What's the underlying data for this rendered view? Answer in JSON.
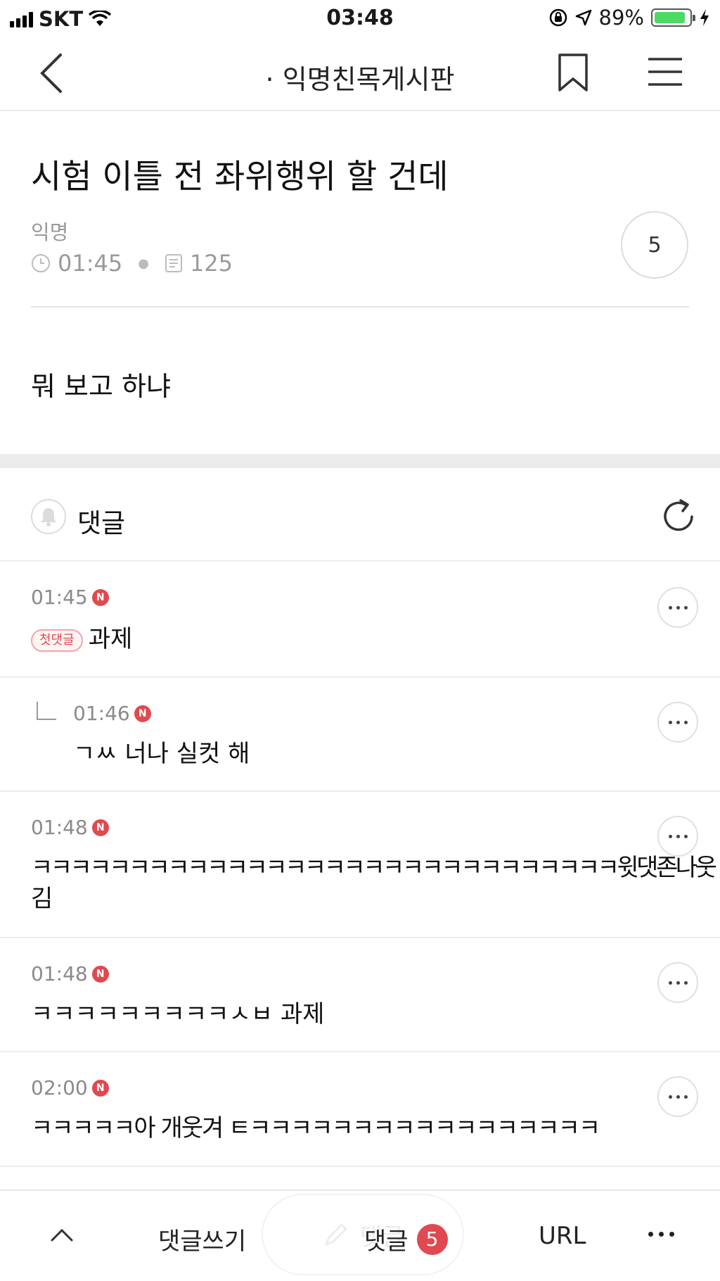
{
  "status_bar": {
    "carrier": "SKT",
    "time": "03:48",
    "battery": "89%",
    "battery_level": 0.89
  },
  "nav": {
    "title": "· 익명친목게시판"
  },
  "post": {
    "title": "시험 이틀 전 좌위행위 할 건데",
    "author": "익명",
    "time": "01:45",
    "views": "125",
    "comment_count": "5",
    "body": "뭐 보고 하냐"
  },
  "comments_section": {
    "title": "댓글"
  },
  "comments": [
    {
      "time": "01:45",
      "badge": "N",
      "tag": "첫댓글",
      "text": "과제",
      "is_reply": false
    },
    {
      "time": "01:46",
      "badge": "N",
      "text": "ㄱㅆ 너나 실컷 해",
      "is_reply": true
    },
    {
      "time": "01:48",
      "badge": "N",
      "text": "ㅋㅋㅋㅋㅋㅋㅋㅋㅋㅋㅋㅋㅋㅋㅋㅋㅋㅋㅋㅋㅋㅋㅋㅋㅋㅋㅋㅋㅋㅋ윗댓존나웃",
      "text_line2": "김",
      "is_reply": false
    },
    {
      "time": "01:48",
      "badge": "N",
      "text": "ㅋㅋㅋㅋㅋㅋㅋㅋㅋㅅㅂ 과제",
      "is_reply": false
    },
    {
      "time": "02:00",
      "badge": "N",
      "text": "ㅋㅋㅋㅋㅋ아 개웃겨 ㅌㅋㅋㅋㅋㅋㅋㅋㅋㅋㅋㅋㅋㅋㅋㅋㅋㅋ",
      "is_reply": false
    }
  ],
  "bottom_bar": {
    "write_label": "댓글쓰기",
    "comments_label": "댓글",
    "comments_count": "5",
    "url_label": "URL",
    "ghost_label": "댓글"
  },
  "colors": {
    "accent_red": "#e0494f",
    "meta_gray": "#9a9a9a",
    "battery_green": "#4cd964"
  }
}
